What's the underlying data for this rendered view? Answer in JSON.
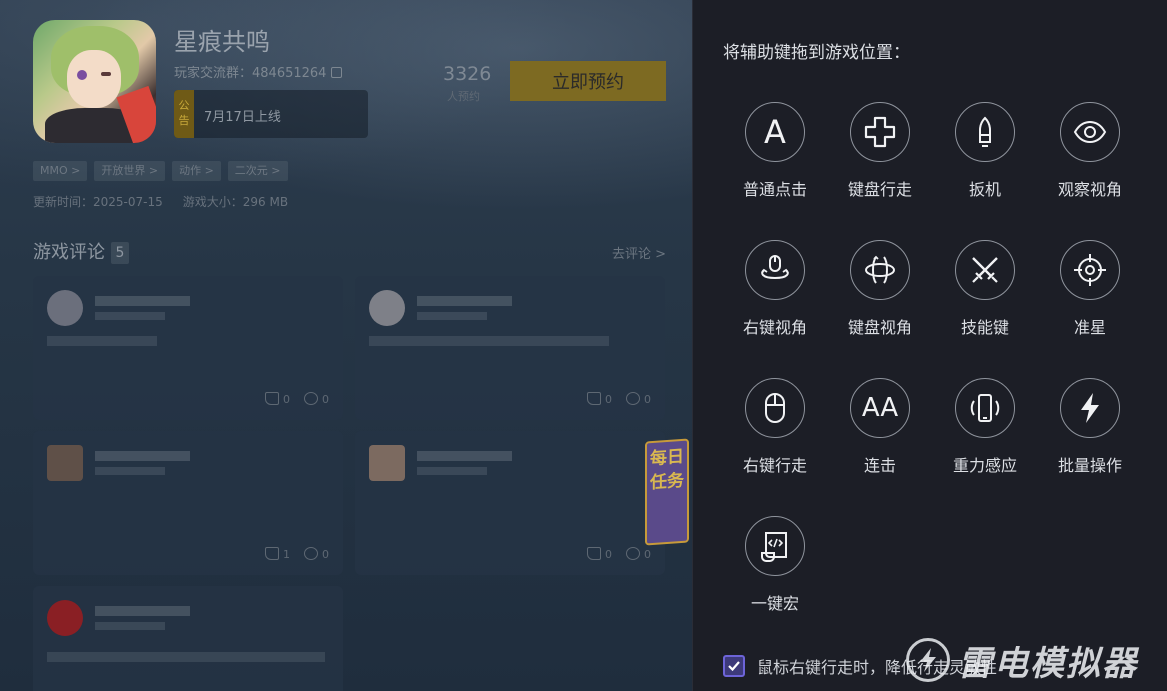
{
  "game": {
    "title": "星痕共鸣",
    "group_label": "玩家交流群：484651264",
    "notice_tag": "公告",
    "notice_text": "7月17日上线",
    "reserve_count": "3326",
    "reserve_label": "人预约",
    "reserve_button": "立即预约",
    "tags": [
      "MMO >",
      "开放世界 >",
      "动作 >",
      "二次元 >"
    ],
    "update_time": "更新时间：2025-07-15",
    "size": "游戏大小：296 MB"
  },
  "reviews": {
    "title": "游戏评论",
    "count": "5",
    "more": "去评论 >",
    "cards": [
      {
        "likes": "0",
        "comments": "0"
      },
      {
        "likes": "0",
        "comments": "0"
      },
      {
        "likes": "1",
        "comments": "0"
      },
      {
        "likes": "0",
        "comments": "0"
      }
    ]
  },
  "daily_task": "每日任务",
  "panel": {
    "title": "将辅助键拖到游戏位置：",
    "tools": [
      {
        "label": "普通点击",
        "icon": "letter-a-icon",
        "glyph": "A"
      },
      {
        "label": "键盘行走",
        "icon": "dpad-cross-icon"
      },
      {
        "label": "扳机",
        "icon": "bullet-icon"
      },
      {
        "label": "观察视角",
        "icon": "eye-icon"
      },
      {
        "label": "右键视角",
        "icon": "mouse-orbit-icon"
      },
      {
        "label": "键盘视角",
        "icon": "rotate-view-icon"
      },
      {
        "label": "技能键",
        "icon": "crossed-swords-icon"
      },
      {
        "label": "准星",
        "icon": "crosshair-icon"
      },
      {
        "label": "右键行走",
        "icon": "mouse-icon"
      },
      {
        "label": "连击",
        "icon": "double-a-icon",
        "glyph": "AA"
      },
      {
        "label": "重力感应",
        "icon": "phone-shake-icon"
      },
      {
        "label": "批量操作",
        "icon": "lightning-icon"
      },
      {
        "label": "一键宏",
        "icon": "script-scroll-icon"
      }
    ],
    "checkbox_label": "鼠标右键行走时，降低行走灵敏性",
    "checkbox_checked": true
  },
  "brand": {
    "name": "雷电模拟器"
  },
  "colors": {
    "accent": "#6d64d8",
    "panel_bg": "#1c1e26",
    "reserve_button": "#7d6a22"
  }
}
